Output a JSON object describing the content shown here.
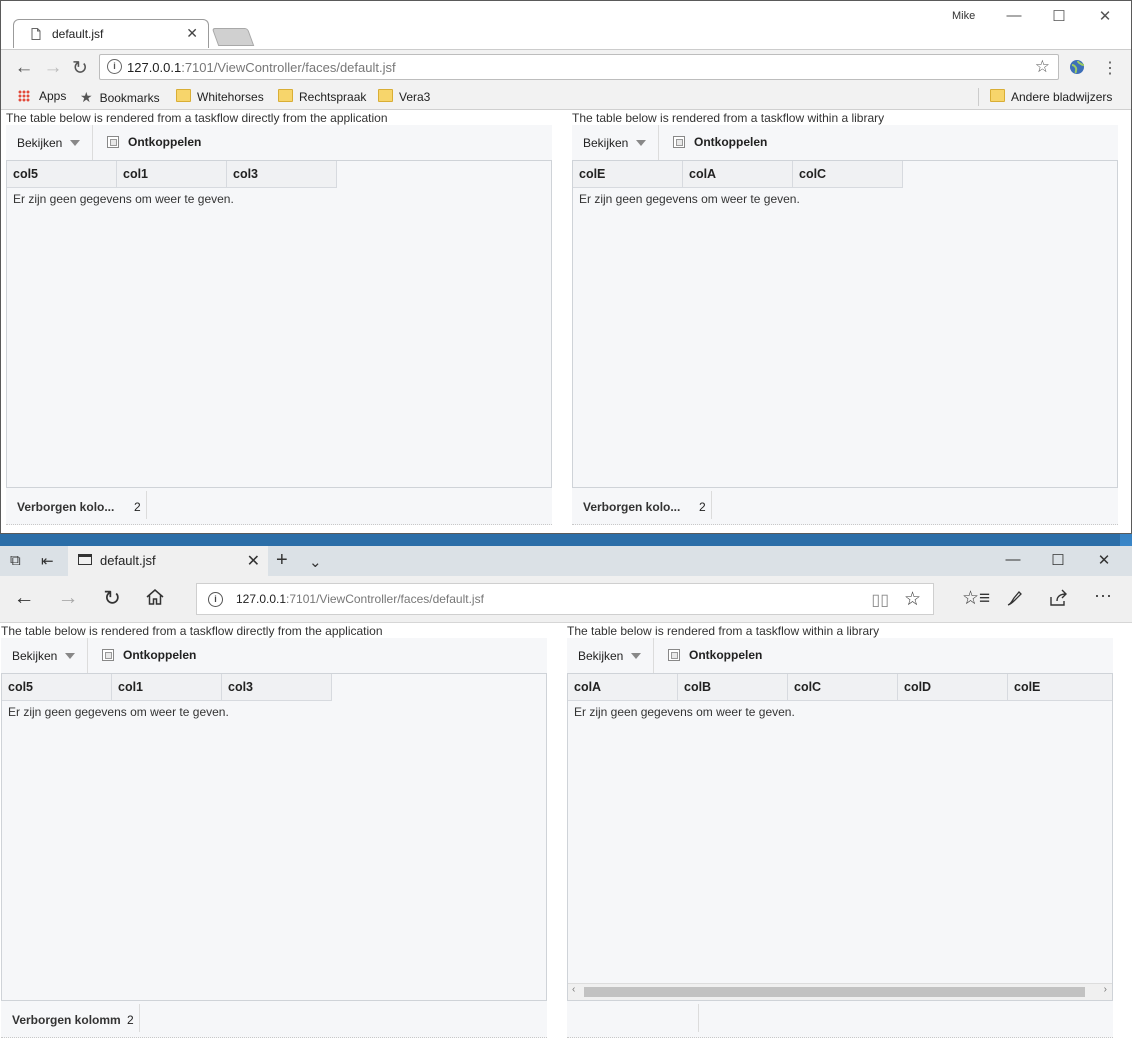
{
  "chrome": {
    "tab_title": "default.jsf",
    "user": "Mike",
    "url_host": "127.0.0.1",
    "url_path": ":7101/ViewController/faces/default.jsf",
    "bookmarks": {
      "apps": "Apps",
      "bookmarks": "Bookmarks",
      "whitehorses": "Whitehorses",
      "rechtspraak": "Rechtspraak",
      "vera3": "Vera3",
      "other": "Andere bladwijzers"
    },
    "left_panel": {
      "caption": "The table below is rendered from a taskflow directly from the application",
      "view_label": "Bekijken",
      "detach_label": "Ontkoppelen",
      "columns": [
        "col5",
        "col1",
        "col3"
      ],
      "empty_text": "Er zijn geen gegevens om weer te geven.",
      "hidden_label": "Verborgen kolo...",
      "hidden_count": "2"
    },
    "right_panel": {
      "caption": "The table below is rendered from a taskflow within a library",
      "view_label": "Bekijken",
      "detach_label": "Ontkoppelen",
      "columns": [
        "colE",
        "colA",
        "colC"
      ],
      "empty_text": "Er zijn geen gegevens om weer te geven.",
      "hidden_label": "Verborgen kolo...",
      "hidden_count": "2"
    }
  },
  "edge": {
    "tab_title": "default.jsf",
    "url_host": "127.0.0.1",
    "url_path": ":7101/ViewController/faces/default.jsf",
    "left_panel": {
      "caption": "The table below is rendered from a taskflow directly from the application",
      "view_label": "Bekijken",
      "detach_label": "Ontkoppelen",
      "columns": [
        "col5",
        "col1",
        "col3"
      ],
      "empty_text": "Er zijn geen gegevens om weer te geven.",
      "hidden_label": "Verborgen kolomm",
      "hidden_count": "2"
    },
    "right_panel": {
      "caption": "The table below is rendered from a taskflow within a library",
      "view_label": "Bekijken",
      "detach_label": "Ontkoppelen",
      "columns": [
        "colA",
        "colB",
        "colC",
        "colD",
        "colE"
      ],
      "empty_text": "Er zijn geen gegevens om weer te geven."
    }
  }
}
